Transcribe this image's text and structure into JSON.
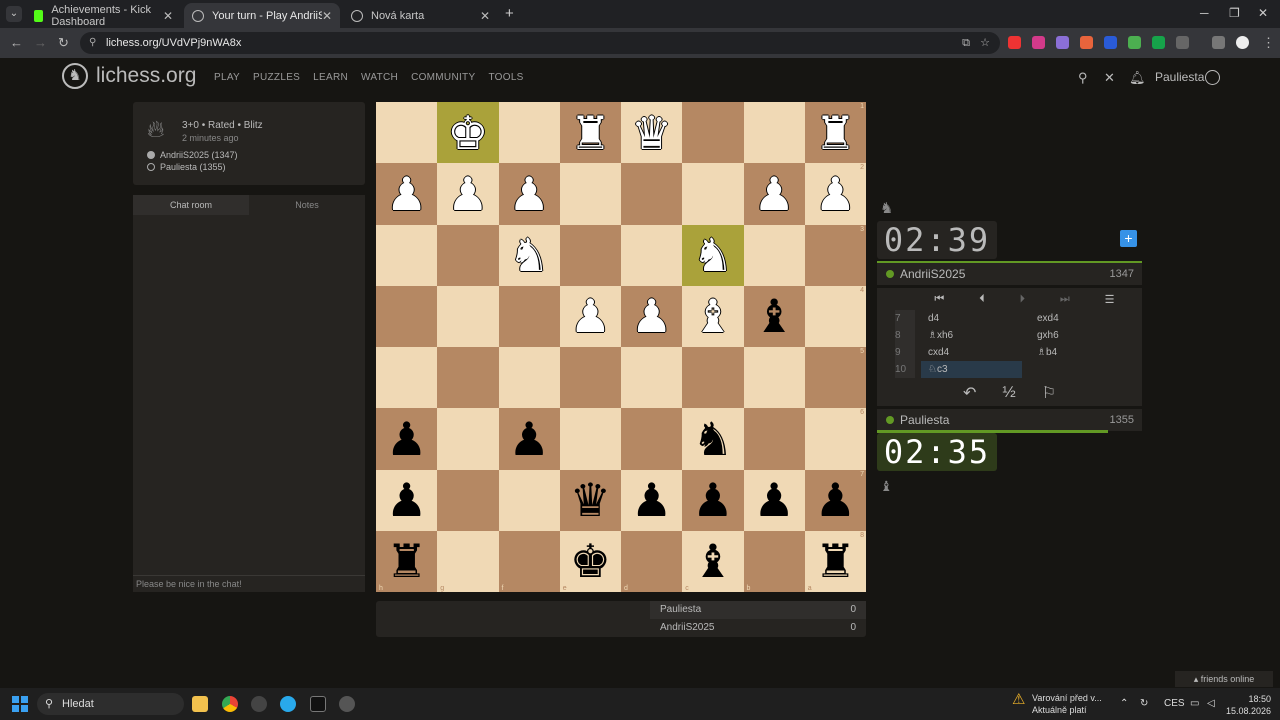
{
  "browser": {
    "tabs": [
      {
        "label": "Achievements - Kick Dashboard",
        "favicon_color": "#53fc18"
      },
      {
        "label": "Your turn - Play AndriiS2025 • l",
        "favicon_color": "#bbbbbb"
      },
      {
        "label": "Nová karta",
        "favicon_color": "#bbbbbb"
      }
    ],
    "url": "lichess.org/UVdVPj9nWA8x"
  },
  "site": {
    "logo_text": "lichess.org",
    "nav": [
      "PLAY",
      "PUZZLES",
      "LEARN",
      "WATCH",
      "COMMUNITY",
      "TOOLS"
    ],
    "username": "Pauliesta"
  },
  "game": {
    "setup": "3+0 • Rated • Blitz",
    "ago": "2 minutes ago",
    "white_player": "AndriiS2025 (1347)",
    "black_player": "Pauliesta (1355)"
  },
  "chat": {
    "tab_chat": "Chat room",
    "tab_notes": "Notes",
    "placeholder": "Please be nice in the chat!"
  },
  "board": {
    "rows": [
      [
        "",
        "♚",
        "",
        "♜",
        "♛",
        "",
        "",
        "♜"
      ],
      [
        "♟",
        "♟",
        "♟",
        "",
        "",
        "",
        "♟",
        "♟"
      ],
      [
        "",
        "",
        "♞",
        "",
        "",
        "♞",
        "",
        ""
      ],
      [
        "",
        "",
        "",
        "♟",
        "♟",
        "♝",
        "♝",
        ""
      ],
      [
        "",
        "",
        "",
        "",
        "",
        "",
        "",
        ""
      ],
      [
        "♟",
        "",
        "♟",
        "",
        "",
        "♞",
        "",
        ""
      ],
      [
        "♟",
        "",
        "",
        "♛",
        "♟",
        "♟",
        "♟",
        "♟"
      ],
      [
        "♜",
        "",
        "",
        "♚",
        "",
        "♝",
        "",
        "♜"
      ]
    ],
    "colors": [
      [
        "",
        "w",
        "",
        "w",
        "w",
        "",
        "",
        "w"
      ],
      [
        "w",
        "w",
        "w",
        "",
        "",
        "",
        "w",
        "w"
      ],
      [
        "",
        "",
        "w",
        "",
        "",
        "w",
        "",
        ""
      ],
      [
        "",
        "",
        "",
        "w",
        "w",
        "w",
        "b",
        ""
      ],
      [
        "",
        "",
        "",
        "",
        "",
        "",
        "",
        ""
      ],
      [
        "b",
        "",
        "b",
        "",
        "",
        "b",
        "",
        ""
      ],
      [
        "b",
        "",
        "",
        "b",
        "b",
        "b",
        "b",
        "b"
      ],
      [
        "b",
        "",
        "",
        "b",
        "",
        "b",
        "",
        "b"
      ]
    ],
    "ranks": [
      "1",
      "2",
      "3",
      "4",
      "5",
      "6",
      "7",
      "8"
    ],
    "files": [
      "h",
      "g",
      "f",
      "e",
      "d",
      "c",
      "b",
      "a"
    ],
    "last_move_squares": [
      "g1",
      "c3"
    ]
  },
  "scoreboard": [
    {
      "name": "Pauliesta",
      "score": "0"
    },
    {
      "name": "AndriiS2025",
      "score": "0"
    }
  ],
  "opponent": {
    "name": "AndriiS2025",
    "rating": "1347",
    "clock": "02:39"
  },
  "me": {
    "name": "Pauliesta",
    "rating": "1355",
    "clock": "02:35"
  },
  "moves": [
    {
      "n": "7",
      "w": "d4",
      "b": "exd4"
    },
    {
      "n": "8",
      "w": "♗xh6",
      "b": "gxh6"
    },
    {
      "n": "9",
      "w": "cxd4",
      "b": "♗b4"
    },
    {
      "n": "10",
      "w": "♘c3",
      "b": ""
    }
  ],
  "friends_online": "friends online",
  "taskbar": {
    "search": "Hledat",
    "warning_line1": "Varování před v...",
    "warning_line2": "Aktuálně platí",
    "lang": "CES",
    "time": "18:50",
    "date": "15.08.2026"
  }
}
